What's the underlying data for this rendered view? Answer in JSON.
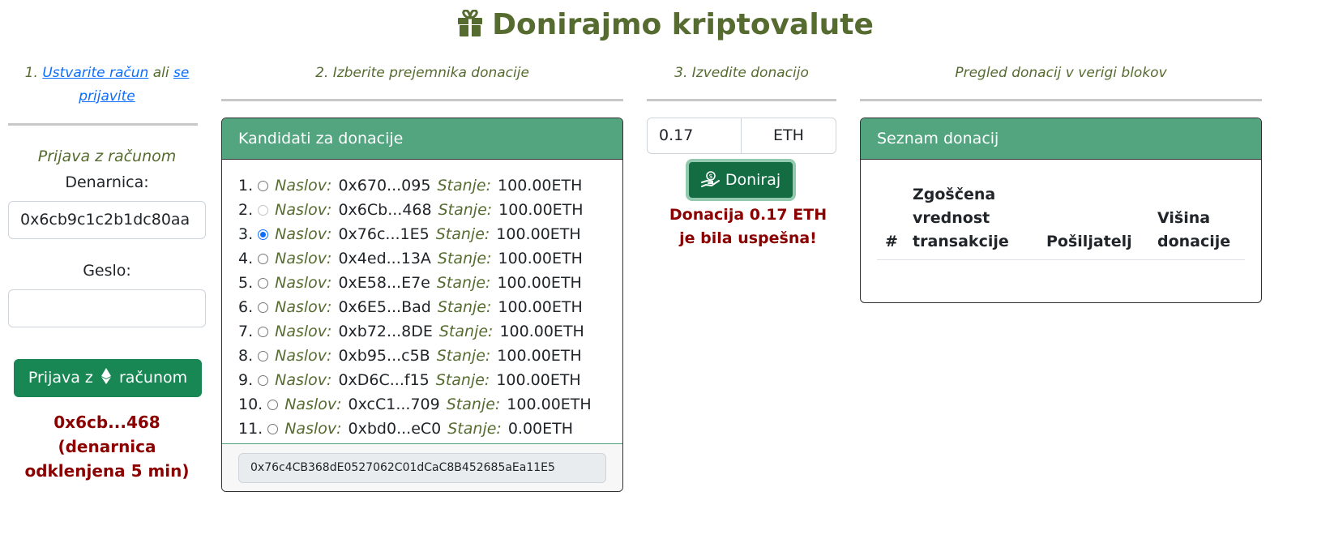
{
  "title": "Donirajmo kriptovalute",
  "steps": {
    "step1_prefix": "1.",
    "step1_link_create": "Ustvarite račun",
    "step1_or": "ali",
    "step1_link_login_a": "se",
    "step1_link_login_b": "prijavite",
    "step2": "2. Izberite prejemnika donacije",
    "step3": "3. Izvedite donacijo",
    "step4": "Pregled donacij v verigi blokov"
  },
  "login": {
    "title": "Prijava z računom",
    "wallet_label": "Denarnica:",
    "wallet_value": "0x6cb9c1c2b1dc80aa",
    "password_label": "Geslo:",
    "password_value": "",
    "button_label_pre": "Prijava z",
    "button_label_post": "računom",
    "status_line1": "0x6cb...468",
    "status_line2": "(denarnica",
    "status_line3": "odklenjena 5 min)"
  },
  "candidates": {
    "header": "Kandidati za donacije",
    "address_key": "Naslov:",
    "balance_key": "Stanje:",
    "items": [
      {
        "num": "1.",
        "address": "0x670...095",
        "balance": "100.00ETH",
        "state": "unchecked"
      },
      {
        "num": "2.",
        "address": "0x6Cb...468",
        "balance": "100.00ETH",
        "state": "disabled"
      },
      {
        "num": "3.",
        "address": "0x76c...1E5",
        "balance": "100.00ETH",
        "state": "checked"
      },
      {
        "num": "4.",
        "address": "0x4ed...13A",
        "balance": "100.00ETH",
        "state": "unchecked"
      },
      {
        "num": "5.",
        "address": "0xE58...E7e",
        "balance": "100.00ETH",
        "state": "unchecked"
      },
      {
        "num": "6.",
        "address": "0x6E5...Bad",
        "balance": "100.00ETH",
        "state": "unchecked"
      },
      {
        "num": "7.",
        "address": "0xb72...8DE",
        "balance": "100.00ETH",
        "state": "unchecked"
      },
      {
        "num": "8.",
        "address": "0xb95...c5B",
        "balance": "100.00ETH",
        "state": "unchecked"
      },
      {
        "num": "9.",
        "address": "0xD6C...f15",
        "balance": "100.00ETH",
        "state": "unchecked"
      },
      {
        "num": "10.",
        "address": "0xcC1...709",
        "balance": "100.00ETH",
        "state": "unchecked"
      },
      {
        "num": "11.",
        "address": "0xbd0...eC0",
        "balance": "0.00ETH",
        "state": "unchecked"
      }
    ],
    "selected_address": "0x76c4CB368dE0527062C01dCaC8B452685aEa11E5"
  },
  "donation": {
    "amount": "0.17",
    "unit": "ETH",
    "button_label": "Doniraj",
    "message_line1": "Donacija 0.17 ETH",
    "message_line2": "je bila uspešna!"
  },
  "donations_list": {
    "header": "Seznam donacij",
    "col_num": "#",
    "col_hash": [
      "Zgoščena",
      "vrednost",
      "transakcije"
    ],
    "col_sender": "Pošiljatelj",
    "col_amount": [
      "Višina",
      "donacije"
    ]
  },
  "colors": {
    "title_olive": "#556b2f",
    "card_header_green": "#52a57f",
    "button_green": "#198754",
    "donate_button": "#146c43",
    "error_red": "#8b0000",
    "link_blue": "#0d6efd"
  }
}
